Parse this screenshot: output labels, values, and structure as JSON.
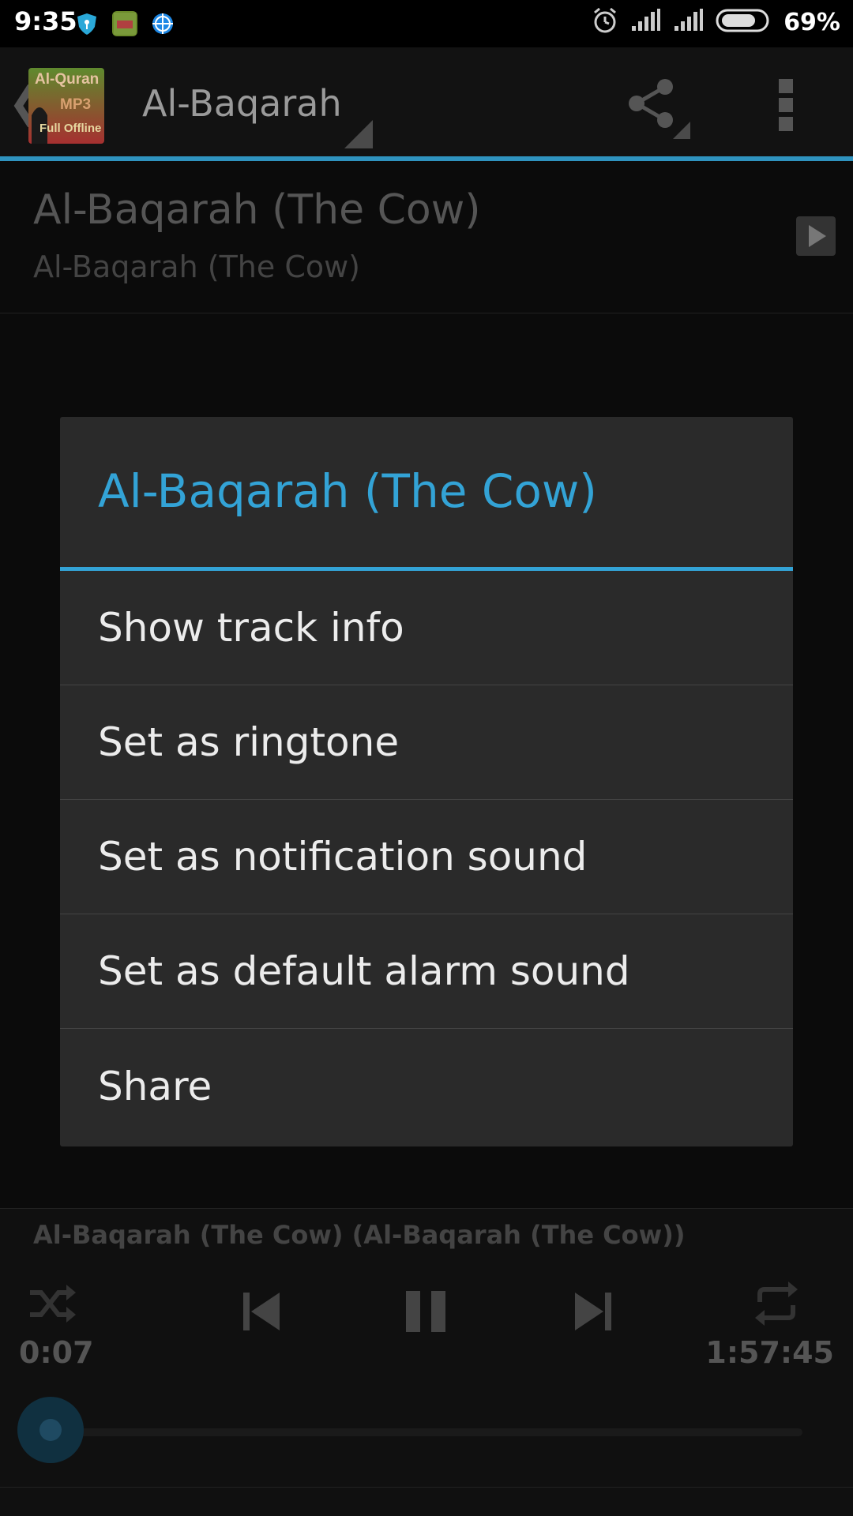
{
  "status_bar": {
    "time": "9:35",
    "battery_percent": "69%",
    "icons": [
      "shield-icon",
      "app-notification-icon",
      "globe-icon",
      "alarm-icon",
      "signal-icon",
      "signal-icon",
      "battery-icon"
    ]
  },
  "app_bar": {
    "title": "Al-Baqarah",
    "logo_text": [
      "Al-Quran",
      "MP3",
      "Full Offline"
    ],
    "actions": [
      "share-icon",
      "overflow-menu-icon"
    ]
  },
  "track": {
    "title": "Al-Baqarah (The Cow)",
    "subtitle": "Al-Baqarah (The Cow)"
  },
  "dialog": {
    "title": "Al-Baqarah (The Cow)",
    "items": [
      "Show track info",
      "Set as ringtone",
      "Set as notification sound",
      "Set as default alarm sound",
      "Share"
    ]
  },
  "player": {
    "now_playing": "Al-Baqarah (The Cow) (Al-Baqarah (The Cow))",
    "time_current": "0:07",
    "time_total": "1:57:45",
    "controls": [
      "shuffle-icon",
      "previous-icon",
      "pause-icon",
      "next-icon",
      "repeat-icon"
    ],
    "progress": 0.001
  },
  "colors": {
    "accent": "#33a3d6",
    "dialog_bg": "#2a2a2a",
    "background": "#0b0b0b"
  }
}
